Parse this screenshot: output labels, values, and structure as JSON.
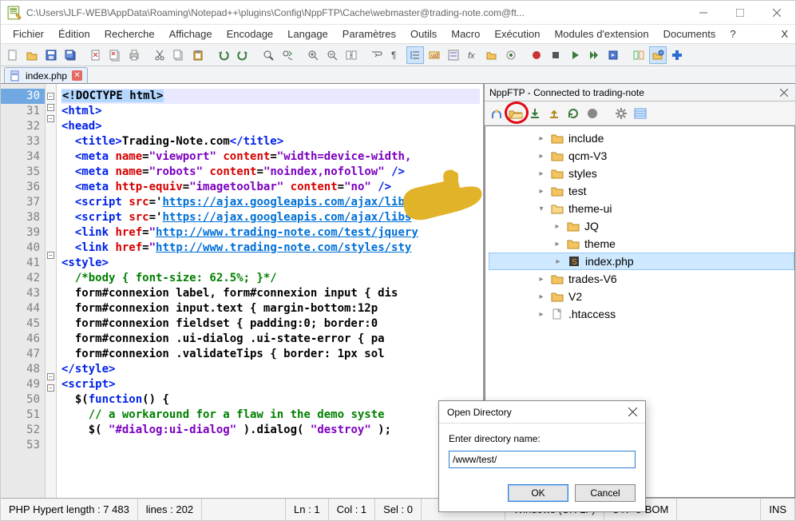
{
  "window": {
    "title": "C:\\Users\\JLF-WEB\\AppData\\Roaming\\Notepad++\\plugins\\Config\\NppFTP\\Cache\\webmaster@trading-note.com@ft..."
  },
  "menu": [
    "Fichier",
    "Édition",
    "Recherche",
    "Affichage",
    "Encodage",
    "Langage",
    "Paramètres",
    "Outils",
    "Macro",
    "Exécution",
    "Modules d'extension",
    "Documents",
    "?",
    "X"
  ],
  "tab": {
    "label": "index.php"
  },
  "ftp": {
    "title": "NppFTP - Connected to trading-note",
    "nodes": [
      {
        "indent": 1,
        "icon": "folder",
        "label": "include"
      },
      {
        "indent": 1,
        "icon": "folder",
        "label": "qcm-V3"
      },
      {
        "indent": 1,
        "icon": "folder",
        "label": "styles"
      },
      {
        "indent": 1,
        "icon": "folder",
        "label": "test"
      },
      {
        "indent": 1,
        "icon": "folder-open",
        "label": "theme-ui",
        "exp": "▾"
      },
      {
        "indent": 2,
        "icon": "folder",
        "label": "JQ"
      },
      {
        "indent": 2,
        "icon": "folder",
        "label": "theme"
      },
      {
        "indent": 2,
        "icon": "file-s",
        "label": "index.php",
        "sel": true
      },
      {
        "indent": 1,
        "icon": "folder",
        "label": "trades-V6"
      },
      {
        "indent": 1,
        "icon": "folder",
        "label": "V2"
      },
      {
        "indent": 1,
        "icon": "file",
        "label": ".htaccess"
      }
    ]
  },
  "dialog": {
    "title": "Open Directory",
    "label": "Enter directory name:",
    "value": "/www/test/",
    "ok": "OK",
    "cancel": "Cancel"
  },
  "status": {
    "c1": "PHP Hypert length : 7 483",
    "c2": "lines : 202",
    "c3": "Ln : 1",
    "c4": "Col : 1",
    "c5": "Sel : 0",
    "c6": "Windows (CR LF)",
    "c7": "UTF-8-BOM",
    "c8": "INS"
  },
  "code": {
    "lines": [
      {
        "n": 30,
        "hl": true,
        "fold": "-",
        "html": "<span class='c-dt'>&lt;!DOCTYPE html&gt;</span>"
      },
      {
        "n": 31,
        "fold": "-",
        "html": "<span class='c-tag'>&lt;html&gt;</span>"
      },
      {
        "n": 32,
        "fold": "-",
        "html": "<span class='c-tag'>&lt;head&gt;</span>"
      },
      {
        "n": 33,
        "html": "  <span class='c-tag'>&lt;title&gt;</span><span class='c-txt'>Trading-Note.com</span><span class='c-tag'>&lt;/title&gt;</span>"
      },
      {
        "n": 34,
        "html": "  <span class='c-tag'>&lt;meta</span> <span class='c-attr'>name</span>=<span class='c-str'>\"viewport\"</span> <span class='c-attr'>content</span>=<span class='c-str'>\"width=device-width,</span>"
      },
      {
        "n": 35,
        "html": "  <span class='c-tag'>&lt;meta</span> <span class='c-attr'>name</span>=<span class='c-str'>\"robots\"</span> <span class='c-attr'>content</span>=<span class='c-str'>\"noindex,nofollow\"</span> <span class='c-tag'>/&gt;</span>"
      },
      {
        "n": 36,
        "html": "  <span class='c-tag'>&lt;meta</span> <span class='c-attr'>http-equiv</span>=<span class='c-str'>\"imagetoolbar\"</span> <span class='c-attr'>content</span>=<span class='c-str'>\"no\"</span> <span class='c-tag'>/&gt;</span>"
      },
      {
        "n": 37,
        "html": "  <span class='c-tag'>&lt;script</span> <span class='c-attr'>src</span>='<span class='c-url'>https://ajax.googleapis.com/ajax/libs</span>"
      },
      {
        "n": 38,
        "html": "  <span class='c-tag'>&lt;script</span> <span class='c-attr'>src</span>='<span class='c-url'>https://ajax.googleapis.com/ajax/libs</span>"
      },
      {
        "n": 39,
        "html": "  <span class='c-tag'>&lt;link</span> <span class='c-attr'>href</span>=<span class='c-str'>\"</span><span class='c-url'>http://www.trading-note.com/test/jquery</span>"
      },
      {
        "n": 40,
        "html": "  <span class='c-tag'>&lt;link</span> <span class='c-attr'>href</span>=<span class='c-str'>\"</span><span class='c-url'>http://www.trading-note.com/styles/sty</span>"
      },
      {
        "n": 41,
        "fold": "-",
        "html": "<span class='c-tag'>&lt;style&gt;</span>"
      },
      {
        "n": 42,
        "html": "  <span class='c-cmt'>/*body { font-size: 62.5%; }*/</span>"
      },
      {
        "n": 43,
        "html": "  <span class='c-txt'>form#connexion label, form#connexion input { dis</span>"
      },
      {
        "n": 44,
        "html": "  <span class='c-txt'>form#connexion input.text { margin-bottom:12p</span>"
      },
      {
        "n": 45,
        "html": "  <span class='c-txt'>form#connexion fieldset { padding:0; border:0</span>"
      },
      {
        "n": 46,
        "html": "  <span class='c-txt'>form#connexion .ui-dialog .ui-state-error { pa</span>"
      },
      {
        "n": 47,
        "html": "  <span class='c-txt'>form#connexion .validateTips { border: 1px sol</span>"
      },
      {
        "n": 48,
        "html": "<span class='c-tag'>&lt;/style&gt;</span>"
      },
      {
        "n": 49,
        "fold": "-",
        "html": "<span class='c-tag'>&lt;script&gt;</span>"
      },
      {
        "n": 50,
        "fold": "-",
        "html": "  <span class='c-txt'>$(</span><span class='c-kw'>function</span><span class='c-txt'>() {</span>"
      },
      {
        "n": 51,
        "html": "    <span class='c-cmt'>// a workaround for a flaw in the demo syste</span>"
      },
      {
        "n": 52,
        "html": "    <span class='c-txt'>$( </span><span class='c-str'>\"#dialog:ui-dialog\"</span><span class='c-txt'> ).dialog( </span><span class='c-str'>\"destroy\"</span><span class='c-txt'> );</span>"
      },
      {
        "n": 53,
        "html": ""
      }
    ]
  }
}
